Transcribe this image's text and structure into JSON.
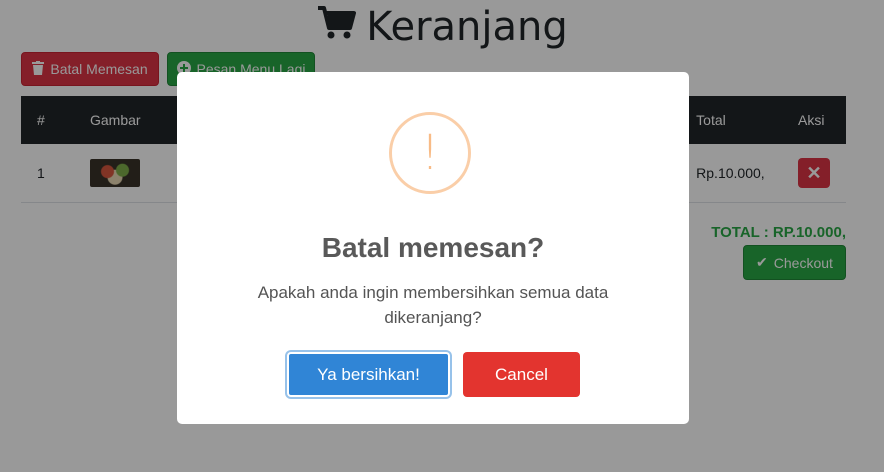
{
  "page": {
    "title": "Keranjang",
    "title_icon": "shopping-cart-icon"
  },
  "toolbar": {
    "batal_label": "Batal Memesan",
    "batal_icon": "trash-icon",
    "pesan_label": "Pesan Menu Lagi",
    "pesan_icon": "plus-circle-icon"
  },
  "table": {
    "headers": [
      "#",
      "Gambar",
      "",
      "",
      "Total",
      "Aksi"
    ],
    "rows": [
      {
        "no": "1",
        "image": "food-thumbnail",
        "total": "Rp.10.000,",
        "action_icon": "close-icon"
      }
    ]
  },
  "summary": {
    "total_text": "TOTAL : RP.10.000,",
    "checkout_label": "Checkout",
    "checkout_icon": "check-icon"
  },
  "dialog": {
    "icon": "warning-icon",
    "icon_glyph": "!",
    "title": "Batal memesan?",
    "text": "Apakah anda ingin membersihkan semua data dikeranjang?",
    "confirm_label": "Ya bersihkan!",
    "cancel_label": "Cancel"
  },
  "colors": {
    "danger": "#dc3545",
    "success": "#28a745",
    "confirm": "#3085d6",
    "cancel": "#e3342f",
    "warning": "#f8bb86"
  }
}
